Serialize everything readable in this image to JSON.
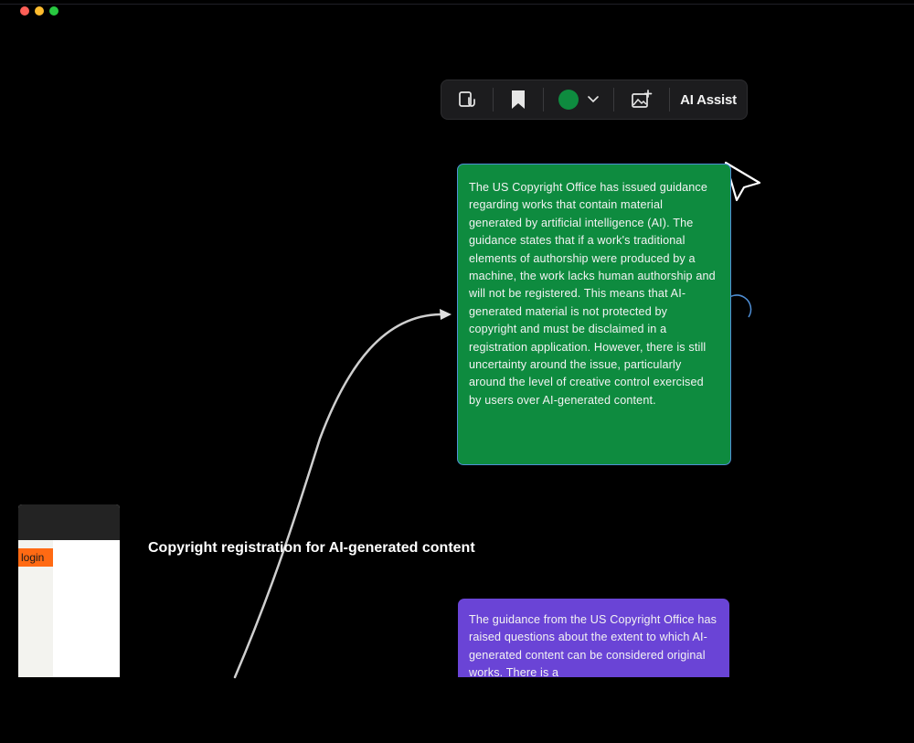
{
  "toolbar": {
    "ai_assist_label": "AI Assist",
    "icons": [
      "link-clip-icon",
      "bookmark-icon",
      "color-picker-icon",
      "chevron-down-icon",
      "add-image-icon"
    ],
    "selected_color": "#0e8b3f"
  },
  "cards": {
    "green": {
      "text": "The US Copyright Office has issued guidance regarding works that contain material generated by artificial intelligence (AI). The guidance states that if a work's traditional elements of authorship were produced by a machine, the work lacks human authorship and will not be registered. This means that AI-generated material is not protected by copyright and must be disclaimed in a registration application. However, there is still uncertainty around the issue, particularly around the level of creative control exercised by users over AI-generated content.",
      "color": "#0e8b3f"
    },
    "purple": {
      "text": "The guidance from the US Copyright Office has raised questions about the extent to which AI-generated content can be considered original works. There is a",
      "color": "#6a44d6"
    }
  },
  "topic": {
    "label": "Copyright registration for AI-generated content"
  },
  "mini_window": {
    "login_label": "login",
    "accent": "#ff6a13"
  }
}
